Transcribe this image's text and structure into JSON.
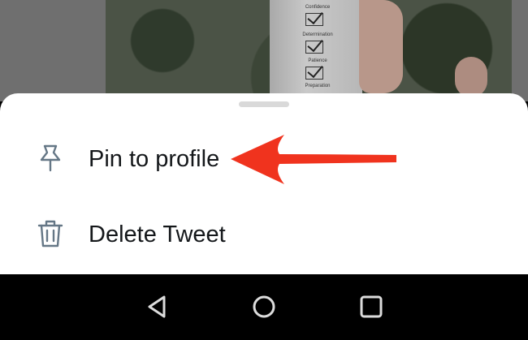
{
  "sheet": {
    "items": [
      {
        "label": "Pin to profile",
        "icon": "pin-icon"
      },
      {
        "label": "Delete Tweet",
        "icon": "trash-icon"
      }
    ]
  },
  "photo": {
    "cup_labels": [
      "Confidence",
      "Determination",
      "Patience",
      "Preparation"
    ]
  },
  "annotation": {
    "arrow_color": "#f0331e",
    "icon": "red-arrow-icon"
  },
  "nav_bar": {
    "buttons": [
      {
        "icon": "back-triangle-icon"
      },
      {
        "icon": "home-circle-icon"
      },
      {
        "icon": "recents-square-icon"
      }
    ]
  },
  "colors": {
    "sheet_bg": "#ffffff",
    "text": "#14171a",
    "icon": "#657786",
    "nav_bg": "#000000"
  }
}
